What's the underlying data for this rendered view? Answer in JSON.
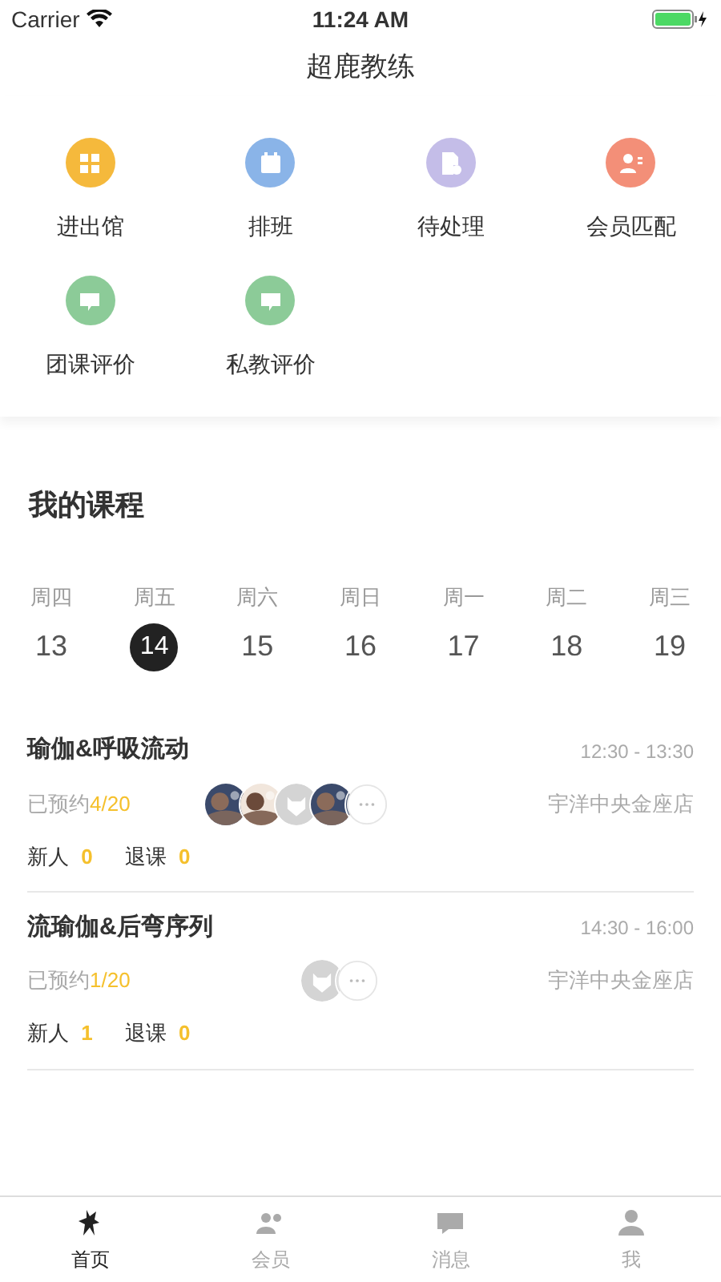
{
  "status_bar": {
    "carrier": "Carrier",
    "time": "11:24 AM"
  },
  "title": "超鹿教练",
  "shortcuts": [
    {
      "label": "进出馆",
      "kind": "grid",
      "color": "#f5b93c"
    },
    {
      "label": "排班",
      "kind": "calendar",
      "color": "#8ab4e8"
    },
    {
      "label": "待处理",
      "kind": "document",
      "color": "#c4bde8"
    },
    {
      "label": "会员匹配",
      "kind": "member",
      "color": "#f38f78"
    },
    {
      "label": "团课评价",
      "kind": "comment",
      "color": "#8ccb98"
    },
    {
      "label": "私教评价",
      "kind": "comment",
      "color": "#8ccb98"
    }
  ],
  "section_title": "我的课程",
  "days": [
    {
      "weekday": "周四",
      "date": "13",
      "selected": false
    },
    {
      "weekday": "周五",
      "date": "14",
      "selected": true
    },
    {
      "weekday": "周六",
      "date": "15",
      "selected": false
    },
    {
      "weekday": "周日",
      "date": "16",
      "selected": false
    },
    {
      "weekday": "周一",
      "date": "17",
      "selected": false
    },
    {
      "weekday": "周二",
      "date": "18",
      "selected": false
    },
    {
      "weekday": "周三",
      "date": "19",
      "selected": false
    }
  ],
  "courses": [
    {
      "name": "瑜伽&呼吸流动",
      "time": "12:30 - 13:30",
      "booked_label": "已预约",
      "booked": "4/20",
      "store": "宇洋中央金座店",
      "new_label": "新人",
      "new_count": "0",
      "cancel_label": "退课",
      "cancel_count": "0",
      "avatars": [
        {
          "kind": "picture"
        },
        {
          "kind": "picture"
        },
        {
          "kind": "default"
        },
        {
          "kind": "picture"
        },
        {
          "kind": "more"
        }
      ]
    },
    {
      "name": "流瑜伽&后弯序列",
      "time": "14:30 - 16:00",
      "booked_label": "已预约",
      "booked": "1/20",
      "store": "宇洋中央金座店",
      "new_label": "新人",
      "new_count": "1",
      "cancel_label": "退课",
      "cancel_count": "0",
      "avatars": [
        {
          "kind": "default"
        },
        {
          "kind": "more"
        }
      ]
    }
  ],
  "tabs": [
    {
      "label": "首页",
      "kind": "home",
      "selected": true
    },
    {
      "label": "会员",
      "kind": "members",
      "selected": false
    },
    {
      "label": "消息",
      "kind": "message",
      "selected": false
    },
    {
      "label": "我",
      "kind": "profile",
      "selected": false
    }
  ]
}
